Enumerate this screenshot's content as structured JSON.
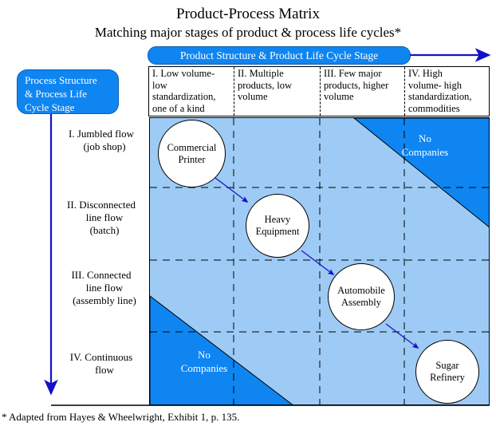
{
  "title": {
    "line1": "Product-Process Matrix",
    "line2": "Matching major stages of product & process life cycles*"
  },
  "banners": {
    "product_axis": "Product Structure & Product Life Cycle Stage",
    "process_axis": "Process Structure & Process Life Cycle Stage",
    "process_axis_lines": [
      "Process Structure",
      "& Process Life",
      "Cycle Stage"
    ]
  },
  "colors": {
    "banner_blue": "#0f85f2",
    "matrix_light_blue": "#9ecbf5",
    "matrix_dark_blue": "#0f85f2",
    "arrow_blue": "#1111cc",
    "border_black": "#000000",
    "bubble_fill": "#ffffff"
  },
  "columns": [
    {
      "id": "I",
      "label": "I. Low volume- low standardization, one of a kind",
      "lines": [
        "I. Low volume-",
        "low",
        "standardization,",
        "one of a kind"
      ]
    },
    {
      "id": "II",
      "label": "II.  Multiple products, low volume",
      "lines": [
        "II.  Multiple",
        "products, low",
        "volume"
      ]
    },
    {
      "id": "III",
      "label": "III.  Few major products, higher volume",
      "lines": [
        "III.  Few major",
        "products, higher",
        "volume"
      ]
    },
    {
      "id": "IV",
      "label": "IV.  High volume- high standardization, commodities",
      "lines": [
        "IV.  High",
        "volume- high",
        "standardization,",
        "commodities"
      ]
    }
  ],
  "rows": [
    {
      "id": "I",
      "lines": [
        "I. Jumbled flow",
        "(job shop)"
      ]
    },
    {
      "id": "II",
      "lines": [
        "II.  Disconnected",
        "line flow",
        "(batch)"
      ]
    },
    {
      "id": "III",
      "lines": [
        "III.  Connected",
        "line flow",
        "(assembly line)"
      ]
    },
    {
      "id": "IV",
      "lines": [
        "IV.  Continuous",
        "flow"
      ]
    }
  ],
  "bubbles": [
    {
      "name": "commercial-printer",
      "lines": [
        "Commercial",
        "Printer"
      ],
      "row": "I",
      "col": "I"
    },
    {
      "name": "heavy-equipment",
      "lines": [
        "Heavy",
        "Equipment"
      ],
      "row": "II",
      "col": "II"
    },
    {
      "name": "automobile-assembly",
      "lines": [
        "Automobile",
        "Assembly"
      ],
      "row": "III",
      "col": "III"
    },
    {
      "name": "sugar-refinery",
      "lines": [
        "Sugar",
        "Refinery"
      ],
      "row": "IV",
      "col": "IV"
    }
  ],
  "regions": [
    {
      "name": "no-companies-top-right",
      "lines": [
        "No",
        "Companies"
      ]
    },
    {
      "name": "no-companies-bottom-left",
      "lines": [
        "No",
        "Companies"
      ]
    }
  ],
  "footnote": "* Adapted from Hayes & Wheelwright, Exhibit 1, p. 135."
}
